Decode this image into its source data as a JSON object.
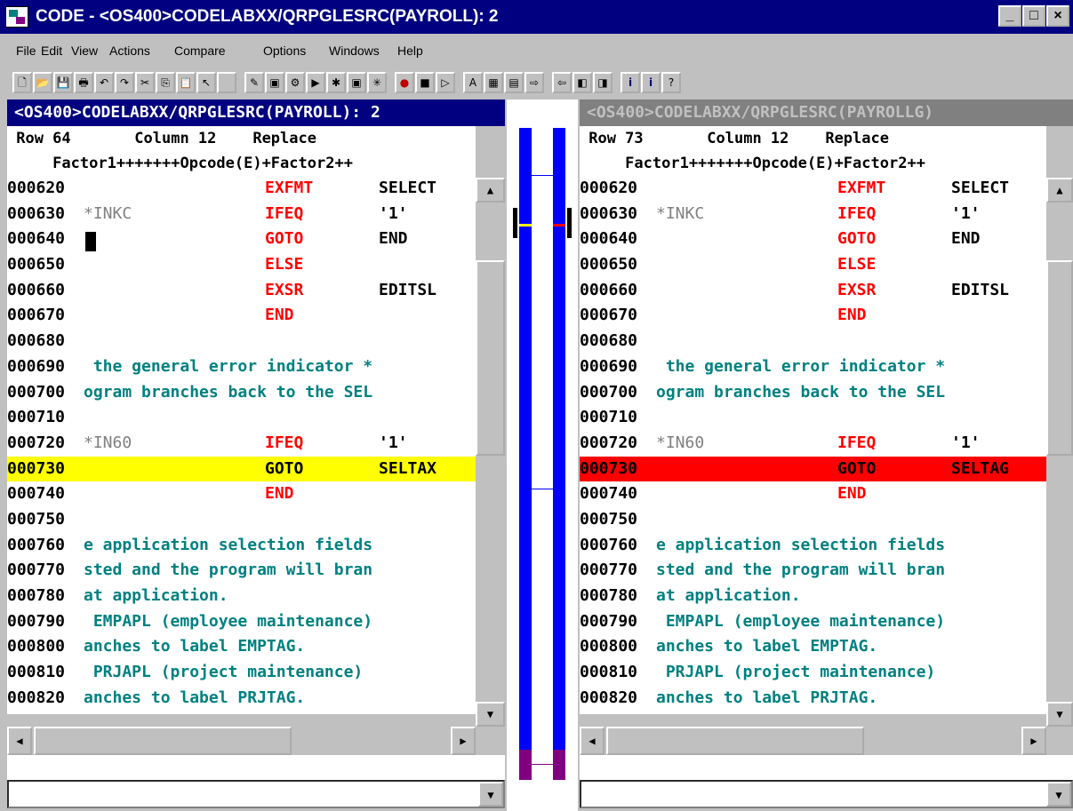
{
  "window": {
    "title": "CODE - <OS400>CODELABXX/QRPGLESRC(PAYROLL): 2",
    "controls": {
      "minimize": "_",
      "maximize": "□",
      "close": "×"
    }
  },
  "menu": [
    "File",
    "Edit",
    "View",
    "Actions",
    "Compare",
    "Options",
    "Windows",
    "Help"
  ],
  "toolbar": {
    "icons": [
      "new-file-icon",
      "open-folder-icon",
      "save-icon",
      "print-icon",
      "undo-icon",
      "redo-icon",
      "cut-icon",
      "copy-icon",
      "paste-icon",
      "select-icon",
      "blank-icon",
      "tag-icon",
      "window-icon",
      "build-icon",
      "run-icon",
      "debug-icon",
      "step-icon",
      "bug-icon",
      "record-icon",
      "stop-icon",
      "play-icon",
      "aa-icon",
      "grid-icon",
      "layout-icon",
      "export-icon",
      "import-icon",
      "back-icon",
      "forward-icon",
      "info-icon",
      "info-dark-icon",
      "help-book-icon"
    ]
  },
  "colors": {
    "titlebar": "#000080",
    "active_header": "#000080",
    "inactive_header": "#808080",
    "change_left": "#ffff00",
    "change_right": "#ff0000",
    "opcode": "#ff0000",
    "comment": "#008080",
    "diff_bar": "#0000ff",
    "diff_bottom": "#800080"
  },
  "left": {
    "header": "<OS400>CODELABXX/QRPGLESRC(PAYROLL): 2",
    "status": " Row 64       Column 12    Replace",
    "ruler": "     Factor1+++++++Opcode(E)+Factor2++",
    "rows": [
      {
        "seq": "000620",
        "ind": "",
        "op": "EXFMT",
        "f2": "SELECT"
      },
      {
        "seq": "000630",
        "ind": "*INKC",
        "op": "IFEQ",
        "f2": "'1'"
      },
      {
        "seq": "000640",
        "ind": "",
        "op": "GOTO",
        "f2": "END"
      },
      {
        "seq": "000650",
        "ind": "",
        "op": "ELSE",
        "f2": ""
      },
      {
        "seq": "000660",
        "ind": "",
        "op": "EXSR",
        "f2": "EDITSL"
      },
      {
        "seq": "000670",
        "ind": "",
        "op": "END",
        "f2": ""
      },
      {
        "seq": "000680",
        "ind": "",
        "op": "",
        "f2": ""
      },
      {
        "seq": "000690",
        "cmt": " the general error indicator *"
      },
      {
        "seq": "000700",
        "cmt": "ogram branches back to the SEL"
      },
      {
        "seq": "000710",
        "ind": "",
        "op": "",
        "f2": ""
      },
      {
        "seq": "000720",
        "ind": "*IN60",
        "op": "IFEQ",
        "f2": "'1'"
      },
      {
        "seq": "000730",
        "ind": "",
        "op": "GOTO",
        "f2": "SELTAX",
        "hl": "#ffff00"
      },
      {
        "seq": "000740",
        "ind": "",
        "op": "END",
        "f2": ""
      },
      {
        "seq": "000750",
        "ind": "",
        "op": "",
        "f2": ""
      },
      {
        "seq": "000760",
        "cmt": "e application selection fields"
      },
      {
        "seq": "000770",
        "cmt": "sted and the program will bran"
      },
      {
        "seq": "000780",
        "cmt": "at application."
      },
      {
        "seq": "000790",
        "cmt": " EMPAPL (employee maintenance)"
      },
      {
        "seq": "000800",
        "cmt": "anches to label EMPTAG."
      },
      {
        "seq": "000810",
        "cmt": " PRJAPL (project maintenance)"
      },
      {
        "seq": "000820",
        "cmt": "anches to label PRJTAG."
      }
    ]
  },
  "right": {
    "header": "<OS400>CODELABXX/QRPGLESRC(PAYROLLG)",
    "status": " Row 73       Column 12    Replace",
    "ruler": "     Factor1+++++++Opcode(E)+Factor2++",
    "rows": [
      {
        "seq": "000620",
        "ind": "",
        "op": "EXFMT",
        "f2": "SELECT"
      },
      {
        "seq": "000630",
        "ind": "*INKC",
        "op": "IFEQ",
        "f2": "'1'"
      },
      {
        "seq": "000640",
        "ind": "",
        "op": "GOTO",
        "f2": "END"
      },
      {
        "seq": "000650",
        "ind": "",
        "op": "ELSE",
        "f2": ""
      },
      {
        "seq": "000660",
        "ind": "",
        "op": "EXSR",
        "f2": "EDITSL"
      },
      {
        "seq": "000670",
        "ind": "",
        "op": "END",
        "f2": ""
      },
      {
        "seq": "000680",
        "ind": "",
        "op": "",
        "f2": ""
      },
      {
        "seq": "000690",
        "cmt": " the general error indicator *"
      },
      {
        "seq": "000700",
        "cmt": "ogram branches back to the SEL"
      },
      {
        "seq": "000710",
        "ind": "",
        "op": "",
        "f2": ""
      },
      {
        "seq": "000720",
        "ind": "*IN60",
        "op": "IFEQ",
        "f2": "'1'"
      },
      {
        "seq": "000730",
        "ind": "",
        "op": "GOTO",
        "f2": "SELTAG",
        "hl": "#ff0000"
      },
      {
        "seq": "000740",
        "ind": "",
        "op": "END",
        "f2": ""
      },
      {
        "seq": "000750",
        "ind": "",
        "op": "",
        "f2": ""
      },
      {
        "seq": "000760",
        "cmt": "e application selection fields"
      },
      {
        "seq": "000770",
        "cmt": "sted and the program will bran"
      },
      {
        "seq": "000780",
        "cmt": "at application."
      },
      {
        "seq": "000790",
        "cmt": " EMPAPL (employee maintenance)"
      },
      {
        "seq": "000800",
        "cmt": "anches to label EMPTAG."
      },
      {
        "seq": "000810",
        "cmt": " PRJAPL (project maintenance)"
      },
      {
        "seq": "000820",
        "cmt": "anches to label PRJTAG."
      }
    ]
  },
  "command_line": {
    "left": "",
    "right": ""
  }
}
